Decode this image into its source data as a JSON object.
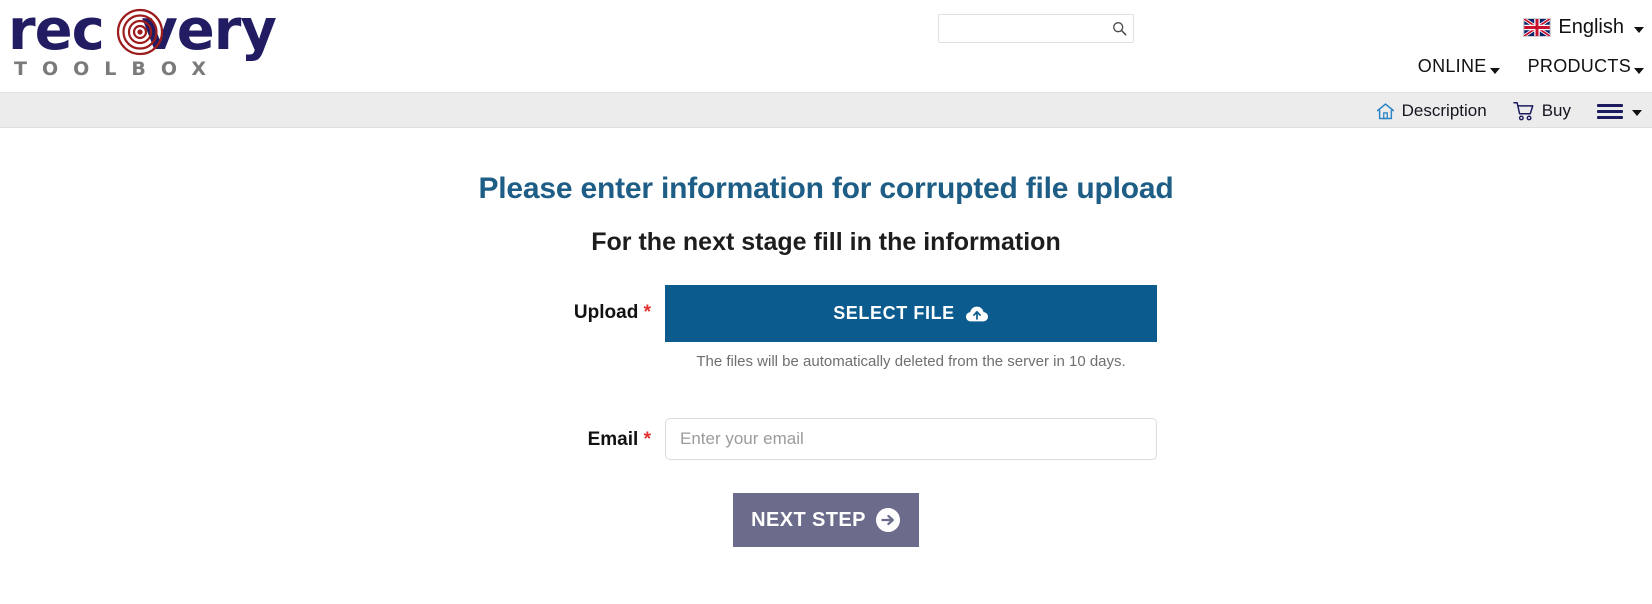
{
  "header": {
    "logo": {
      "word": "recovery",
      "sub": "TOOLBOX",
      "word_color": "#221c62",
      "target_color": "#9e1b1b",
      "sub_color": "#7a7a7a"
    },
    "search": {
      "value": "",
      "placeholder": "",
      "icon": "search-icon"
    },
    "language": {
      "label": "English",
      "flag": "uk-flag-icon",
      "caret": "chevron-down-icon"
    },
    "nav": [
      {
        "label": "ONLINE",
        "caret": "chevron-down-icon"
      },
      {
        "label": "PRODUCTS",
        "caret": "chevron-down-icon"
      }
    ]
  },
  "subnav": {
    "description": {
      "label": "Description",
      "icon": "home-icon"
    },
    "buy": {
      "label": "Buy",
      "icon": "cart-icon"
    },
    "menu": {
      "icon": "hamburger-icon",
      "caret": "chevron-down-icon"
    }
  },
  "main": {
    "title": "Please enter information for corrupted file upload",
    "title_color": "#1d5d86",
    "subtitle": "For the next stage fill in the information",
    "upload": {
      "label": "Upload",
      "required_marker": "*",
      "button_label": "SELECT FILE",
      "button_icon": "cloud-upload-icon",
      "button_color": "#0b5b8e",
      "note": "The files will be automatically deleted from the server in 10 days."
    },
    "email": {
      "label": "Email",
      "required_marker": "*",
      "value": "",
      "placeholder": "Enter your email"
    },
    "next": {
      "label": "NEXT STEP",
      "icon": "arrow-right-circle-icon",
      "color": "#6b6b8c"
    }
  }
}
